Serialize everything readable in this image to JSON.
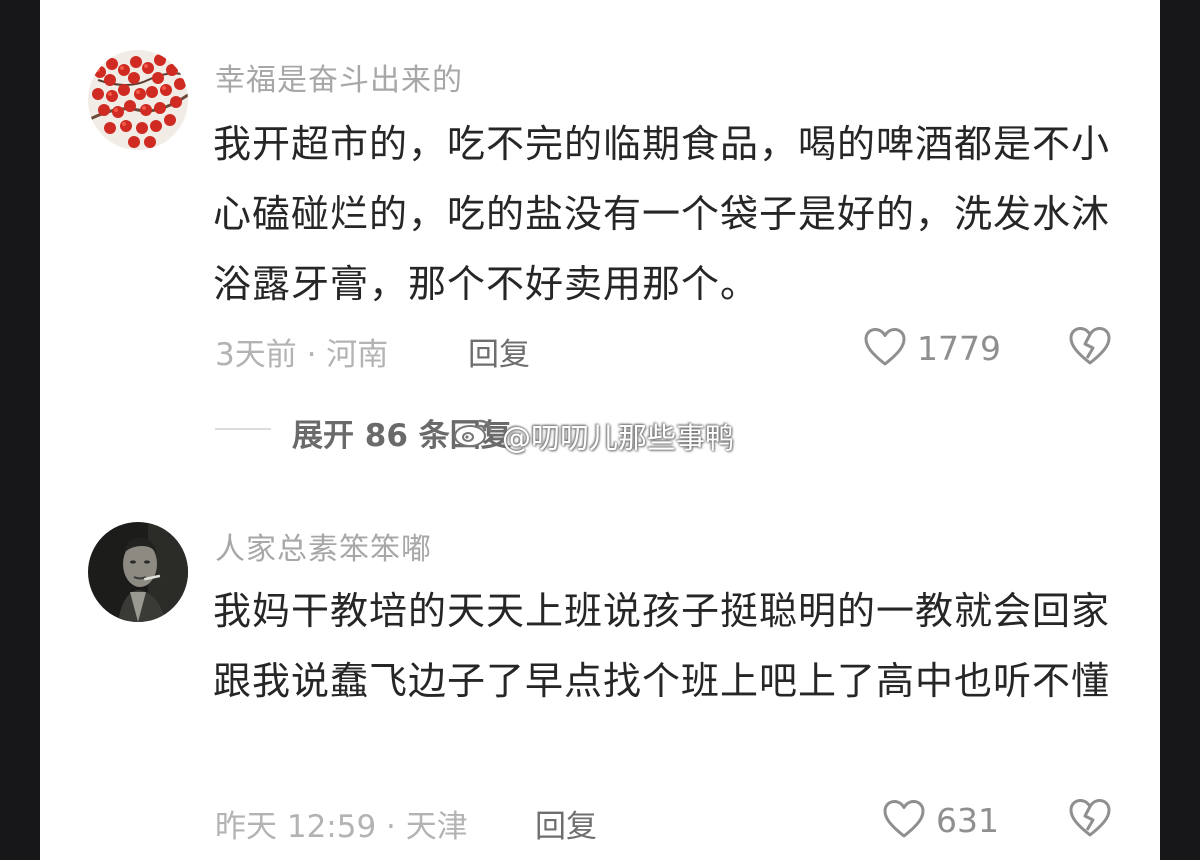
{
  "comments": [
    {
      "username": "幸福是奋斗出来的",
      "text": "我开超市的，吃不完的临期食品，喝的啤酒都是不小心磕碰烂的，吃的盐没有一个袋子是好的，洗发水沐浴露牙膏，那个不好卖用那个。",
      "meta": "3天前 · 河南",
      "reply_label": "回复",
      "likes": "1779",
      "avatar_icon": "red-berries-avatar"
    },
    {
      "username": "人家总素笨笨嘟",
      "text": "我妈干教培的天天上班说孩子挺聪明的一教就会回家跟我说蠢飞边子了早点找个班上吧上了高中也听不懂",
      "meta": "昨天 12:59 · 天津",
      "reply_label": "回复",
      "likes": "631",
      "avatar_icon": "man-portrait-avatar"
    }
  ],
  "expand_replies": {
    "label": "展开 86 条回复"
  },
  "watermark": {
    "text": "@叨叨儿那些事鸭",
    "icon": "weibo-logo-icon"
  },
  "icons": {
    "like": "heart-outline-icon",
    "dislike": "broken-heart-icon"
  },
  "colors": {
    "background": "#ffffff",
    "frame": "#17171a",
    "text": "#262626",
    "muted": "#b3b3b3"
  }
}
